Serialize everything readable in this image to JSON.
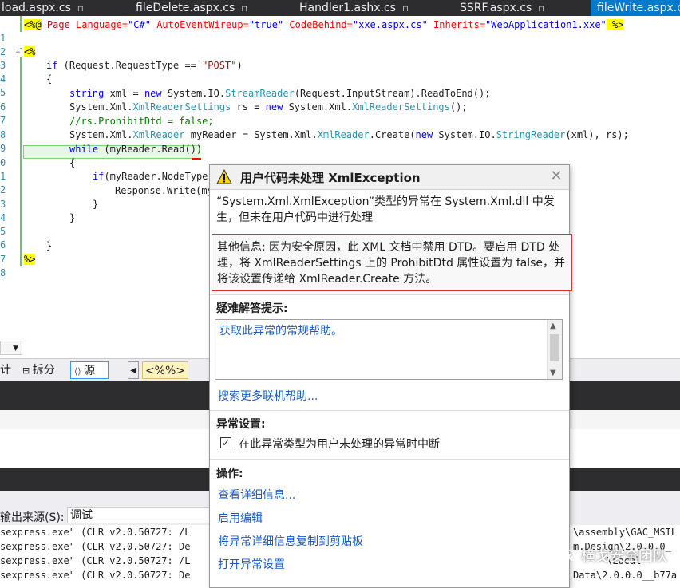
{
  "tabs": [
    {
      "label": "load.aspx.cs",
      "pinned": true
    },
    {
      "label": "fileDelete.aspx.cs",
      "pinned": true
    },
    {
      "label": "Handler1.ashx.cs",
      "pinned": true
    },
    {
      "label": "SSRF.aspx.cs",
      "pinned": true
    },
    {
      "label": "fileWrite.aspx.cs",
      "pinned": false
    }
  ],
  "line_numbers": [
    "1",
    "2",
    "3",
    "4",
    "5",
    "6",
    "7",
    "8",
    "9",
    "0",
    "1",
    "2",
    "3",
    "4",
    "5",
    "6",
    "7",
    "8"
  ],
  "code": {
    "l1": {
      "a": "<%@",
      "b": " Page ",
      "c": "Language=",
      "d": "\"C#\"",
      "e": " AutoEventWireup=",
      "f": "\"true\"",
      "g": " CodeBehind=",
      "h": "\"xxe.aspx.cs\"",
      "i": " Inherits=",
      "j": "\"WebApplication1.xxe\"",
      "k": " %>"
    },
    "l3": "<%",
    "l4": {
      "kw": "if",
      "rest": " (Request.RequestType == ",
      "st": "\"POST\"",
      "end": ")"
    },
    "l5": "{",
    "l6": {
      "kw": "string",
      "a": " xml = ",
      "kw2": "new",
      "b": " System.IO.",
      "ty": "StreamReader",
      "c": "(Request.InputStream).ReadToEnd();"
    },
    "l7": {
      "a": "System.Xml.",
      "ty": "XmlReaderSettings",
      "b": " rs = ",
      "kw": "new",
      "c": " System.Xml.",
      "ty2": "XmlReaderSettings",
      "d": "();"
    },
    "l8": "//rs.ProhibitDtd = false;",
    "l9": {
      "a": "System.Xml.",
      "ty": "XmlReader",
      "b": " myReader = System.Xml.",
      "ty2": "XmlReader",
      "c": ".Create(",
      "kw": "new",
      "d": " System.IO.",
      "ty3": "StringReader",
      "e": "(xml), rs);"
    },
    "l10": {
      "kw": "while",
      "a": " (myReader.Read())"
    },
    "l11": "{",
    "l12": {
      "kw": "if",
      "a": "(myReader.NodeType"
    },
    "l13": "Response.Write(my",
    "l14": "}",
    "l15": "}",
    "l17": "}",
    "l18": "%>"
  },
  "design_bar": {
    "left_char": "计",
    "split_icon": "split-icon",
    "split_label": "拆分",
    "source_icon": "source-icon",
    "source_label": "源",
    "prev_arrow": "◀",
    "tag_label": "<%%>"
  },
  "output": {
    "source_label": "输出来源(S):",
    "source_value": "调试",
    "lines": [
      "sexpress.exe\" (CLR v2.0.50727: /L",
      "sexpress.exe\" (CLR v2.0.50727: De",
      "sexpress.exe\" (CLR v2.0.50727: /L",
      "sexpress.exe\" (CLR v2.0.50727: De"
    ],
    "lines_right": [
      "\\assembly\\GAC_MSIL",
      "m.Design\\2.0.0.0_",
      "\\Local",
      "Data\\2.0.0.0__b77a"
    ]
  },
  "dialog": {
    "icon": "warning-icon",
    "title": "用户代码未处理 XmlException",
    "close_icon": "close-icon",
    "message": "“System.Xml.XmlException”类型的异常在 System.Xml.dll 中发生，但未在用户代码中进行处理",
    "additional_info": "其他信息: 因为安全原因，此 XML 文档中禁用 DTD。要启用 DTD 处理，将 XmlReaderSettings 上的 ProhibitDtd 属性设置为 false，并将该设置传递给 XmlReader.Create 方法。",
    "tips_title": "疑难解答提示:",
    "tips_link": "获取此异常的常规帮助。",
    "search_link": "搜索更多联机帮助...",
    "exception_settings_title": "异常设置:",
    "checkbox_label": "在此异常类型为用户未处理的异常时中断",
    "checkbox_checked": true,
    "actions_title": "操作:",
    "actions": [
      "查看详细信息...",
      "启用编辑",
      "将异常详细信息复制到剪贴板",
      "打开异常设置"
    ]
  },
  "watermark": {
    "icon": "wechat-icon",
    "text": "横戈安全团队"
  },
  "colors": {
    "accent": "#007acc",
    "keyword": "#0000ff",
    "type": "#2b91af",
    "string": "#a31515",
    "comment": "#008000",
    "link": "#1a5ac8",
    "highlight_border": "#e03030"
  }
}
